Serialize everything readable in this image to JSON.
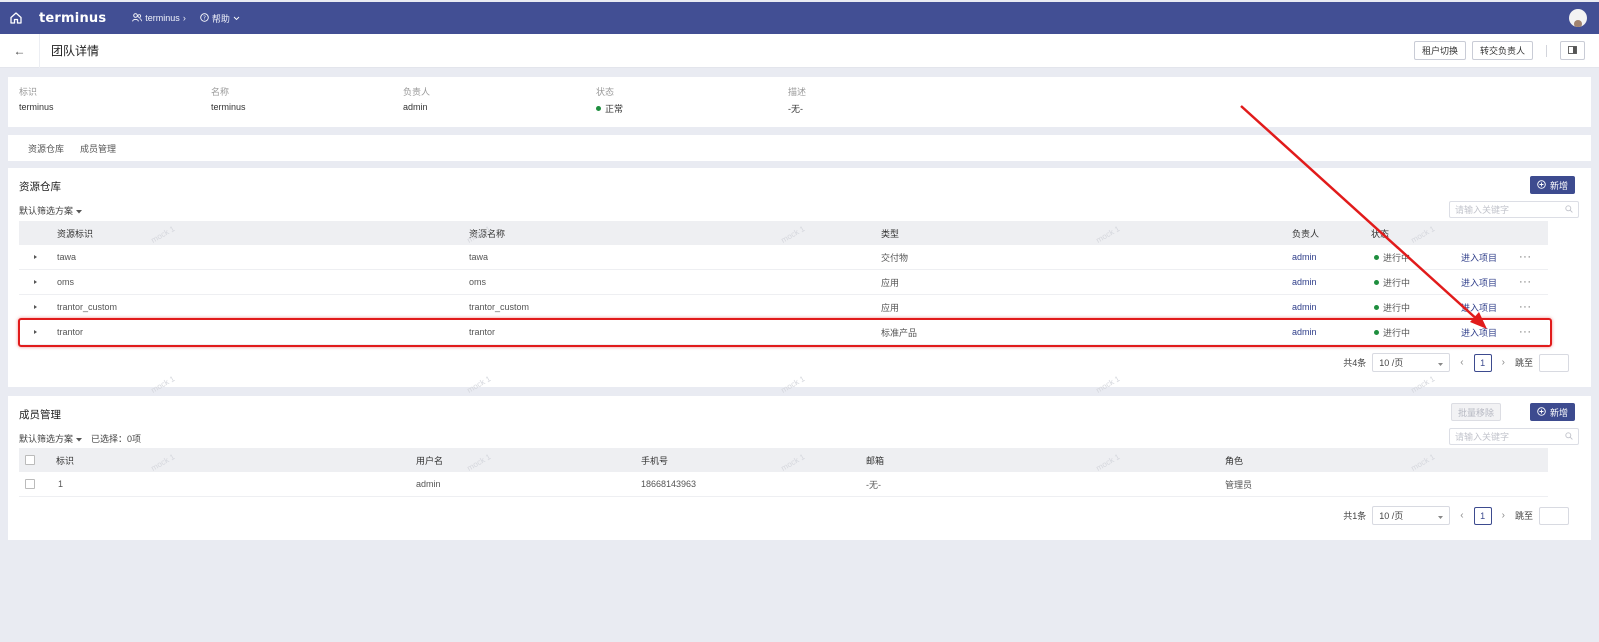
{
  "topnav": {
    "logo": "terminus",
    "team_link": "terminus",
    "help_link": "帮助"
  },
  "titlebar": {
    "title": "团队详情",
    "tenant_switch": "租户切换",
    "transfer_owner": "转交负责人"
  },
  "info": {
    "id_label": "标识",
    "id_value": "terminus",
    "name_label": "名称",
    "name_value": "terminus",
    "owner_label": "负责人",
    "owner_value": "admin",
    "status_label": "状态",
    "status_value": "正常",
    "desc_label": "描述",
    "desc_value": "-无-"
  },
  "tabs": [
    "资源仓库",
    "成员管理"
  ],
  "resources": {
    "title": "资源仓库",
    "add_label": "新增",
    "filter_label": "默认筛选方案",
    "search_placeholder": "请输入关键字",
    "columns": {
      "id": "资源标识",
      "name": "资源名称",
      "type": "类型",
      "owner": "负责人",
      "status": "状态"
    },
    "rows": [
      {
        "id": "tawa",
        "name": "tawa",
        "type": "交付物",
        "owner": "admin",
        "status": "进行中",
        "action": "进入项目"
      },
      {
        "id": "oms",
        "name": "oms",
        "type": "应用",
        "owner": "admin",
        "status": "进行中",
        "action": "进入项目"
      },
      {
        "id": "trantor_custom",
        "name": "trantor_custom",
        "type": "应用",
        "owner": "admin",
        "status": "进行中",
        "action": "进入项目"
      },
      {
        "id": "trantor",
        "name": "trantor",
        "type": "标准产品",
        "owner": "admin",
        "status": "进行中",
        "action": "进入项目"
      }
    ],
    "pager": {
      "total": "共4条",
      "page_size": "10 /页",
      "current": "1",
      "jump": "跳至"
    }
  },
  "members": {
    "title": "成员管理",
    "batch_remove": "批量移除",
    "add_label": "新增",
    "filter_label": "默认筛选方案",
    "selected": "已选择：0项",
    "search_placeholder": "请输入关键字",
    "columns": {
      "id": "标识",
      "username": "用户名",
      "phone": "手机号",
      "email": "邮箱",
      "role": "角色"
    },
    "rows": [
      {
        "id": "1",
        "username": "admin",
        "phone": "18668143963",
        "email": "-无-",
        "role": "管理员"
      }
    ],
    "pager": {
      "total": "共1条",
      "page_size": "10 /页",
      "current": "1",
      "jump": "跳至"
    }
  },
  "watermark": "mock 1",
  "colors": {
    "nav": "#424f94",
    "primary": "#3d4b8f",
    "status_dot": "#1e8e3e",
    "highlight": "#e11b1b"
  }
}
